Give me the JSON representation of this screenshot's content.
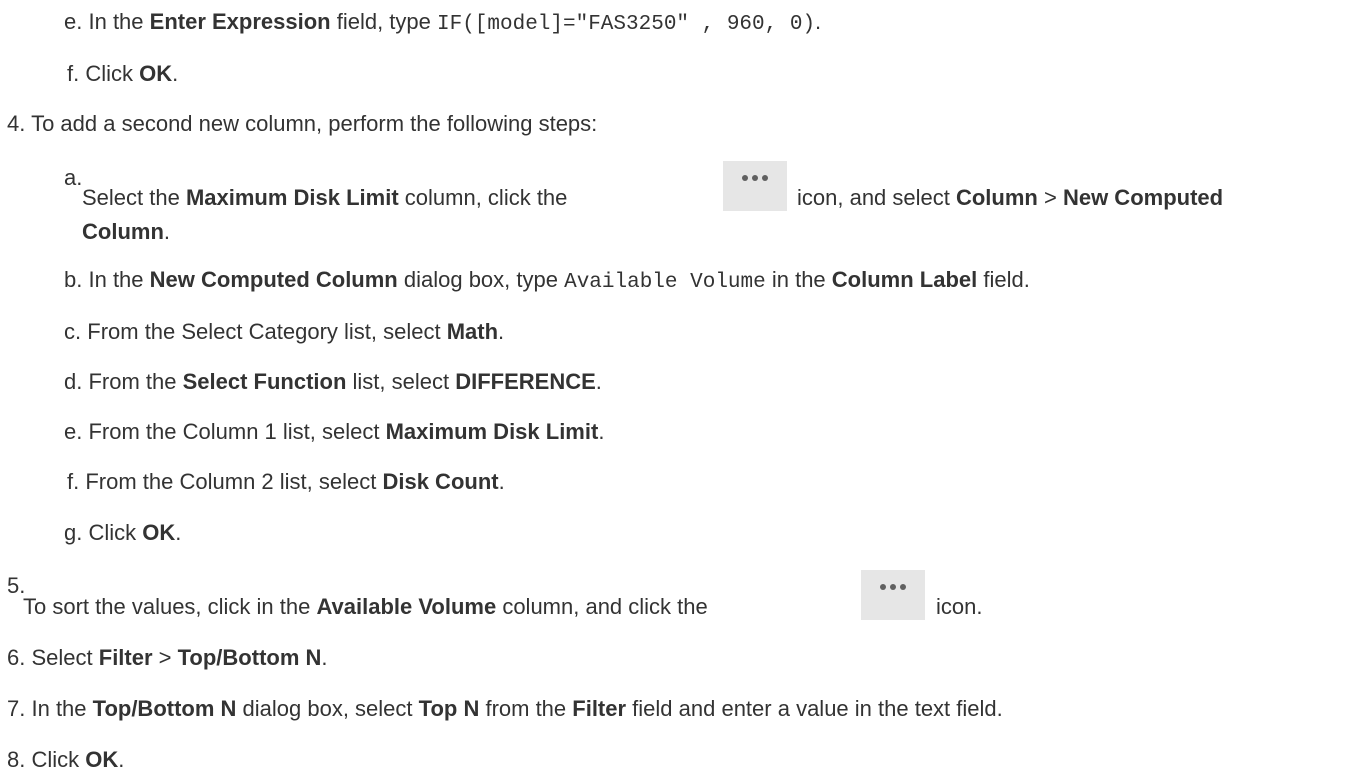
{
  "steps": {
    "s3e": {
      "num": "e.",
      "t1": "In the ",
      "b1": "Enter Expression",
      "t2": " field, type ",
      "code": "IF([model]=\"FAS3250\" , 960, 0)",
      "t3": "."
    },
    "s3f": {
      "num": "f.",
      "t1": "Click ",
      "b1": "OK",
      "t2": "."
    },
    "s4": {
      "num": "4.",
      "t1": "To add a second new column, perform the following steps:"
    },
    "s4a": {
      "num": "a.",
      "t1": "Select the ",
      "b1": "Maximum Disk Limit",
      "t2": " column, click the",
      "t3": "icon, and select ",
      "b2": "Column",
      "t4": " > ",
      "b3": "New Computed",
      "b4": "Column",
      "t5": "."
    },
    "s4b": {
      "num": "b.",
      "t1": "In the ",
      "b1": "New Computed Column",
      "t2": " dialog box, type ",
      "code": "Available Volume",
      "t3": " in the ",
      "b2": "Column Label",
      "t4": " field."
    },
    "s4c": {
      "num": "c.",
      "t1": "From the Select Category list, select ",
      "b1": "Math",
      "t2": "."
    },
    "s4d": {
      "num": "d.",
      "t1": "From the ",
      "b1": "Select Function",
      "t2": " list, select ",
      "b2": "DIFFERENCE",
      "t3": "."
    },
    "s4e": {
      "num": "e.",
      "t1": "From the Column 1 list, select ",
      "b1": "Maximum Disk Limit",
      "t2": "."
    },
    "s4f": {
      "num": "f.",
      "t1": "From the Column 2 list, select ",
      "b1": "Disk Count",
      "t2": "."
    },
    "s4g": {
      "num": "g.",
      "t1": "Click ",
      "b1": "OK",
      "t2": "."
    },
    "s5": {
      "num": "5.",
      "t1": "To sort the values, click in the ",
      "b1": "Available Volume",
      "t2": " column, and click the",
      "t3": "icon."
    },
    "s6": {
      "num": "6.",
      "t1": "Select ",
      "b1": "Filter",
      "t2": " > ",
      "b2": "Top/Bottom N",
      "t3": "."
    },
    "s7": {
      "num": "7.",
      "t1": "In the ",
      "b1": "Top/Bottom N",
      "t2": " dialog box, select ",
      "b2": "Top N",
      "t3": " from the ",
      "b3": "Filter",
      "t4": " field and enter a value in the text field."
    },
    "s8": {
      "num": "8.",
      "t1": "Click ",
      "b1": "OK",
      "t2": "."
    }
  },
  "icons": {
    "more": "more-options-icon"
  }
}
